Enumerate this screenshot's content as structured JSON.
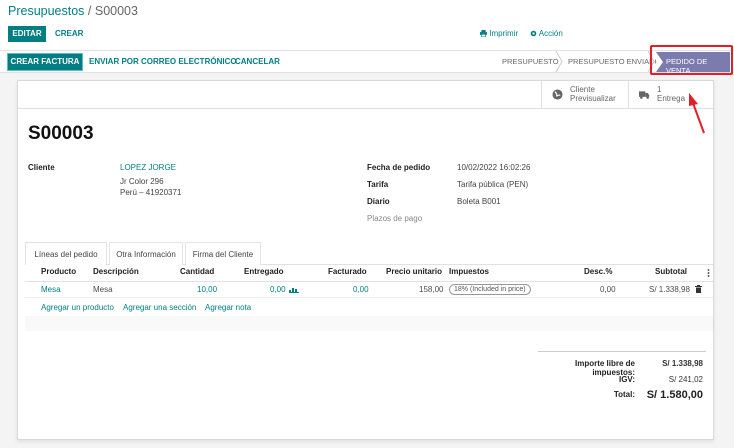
{
  "breadcrumb": {
    "parent": "Presupuestos",
    "separator": " / ",
    "current": "S00003"
  },
  "control": {
    "edit": "EDITAR",
    "create": "CREAR",
    "print": "Imprimir",
    "action": "Acción"
  },
  "statusbar": {
    "invoice": "CREAR FACTURA",
    "send_email": "ENVIAR POR CORREO ELECTRÓNICO",
    "cancel": "CANCELAR",
    "steps": [
      "PRESUPUESTO",
      "PRESUPUESTO ENVIADO",
      "PEDIDO DE VENTA"
    ],
    "active_step": "PEDIDO DE VENTA"
  },
  "smart_buttons": {
    "preview": {
      "line1": "Cliente",
      "line2": "Previsualizar",
      "icon": "globe-icon"
    },
    "delivery": {
      "line1": "1",
      "line2": "Entrega",
      "icon": "truck-icon"
    }
  },
  "order": {
    "name": "S00003",
    "customer_label": "Cliente",
    "customer_name": "LOPEZ JORGE",
    "customer_addr1": "Jr Color 296",
    "customer_addr2": "Perú – 41920371",
    "date_label": "Fecha de pedido",
    "date_value": "10/02/2022 16:02:26",
    "pricelist_label": "Tarifa",
    "pricelist_value": "Tarifa pública (PEN)",
    "journal_label": "Diario",
    "journal_value": "Boleta B001",
    "payment_terms_label": "Plazos de pago"
  },
  "tabs": [
    "Líneas del pedido",
    "Otra Información",
    "Firma del Cliente"
  ],
  "lines_table": {
    "headers": {
      "product": "Producto",
      "description": "Descripción",
      "quantity": "Cantidad",
      "delivered": "Entregado",
      "invoiced": "Facturado",
      "price": "Precio unitario",
      "taxes": "Impuestos",
      "discount": "Desc.%",
      "subtotal": "Subtotal"
    },
    "rows": [
      {
        "product": "Mesa",
        "description": "Mesa",
        "quantity": "10,00",
        "delivered": "0,00",
        "invoiced": "0,00",
        "price": "158,00",
        "tax": "18% (Included in price)",
        "discount": "0,00",
        "subtotal": "S/ 1.338,98"
      }
    ],
    "add_product": "Agregar un producto",
    "add_section": "Agregar una sección",
    "add_note": "Agregar nota"
  },
  "totals": {
    "untaxed_label": "Importe libre de impuestos:",
    "untaxed_value": "S/ 1.338,98",
    "tax_label": "IGV:",
    "tax_value": "S/ 241,02",
    "total_label": "Total:",
    "total_value": "S/ 1.580,00"
  },
  "colors": {
    "primary": "#017e84",
    "status_active": "#7c7bad",
    "highlight": "#e41e26"
  }
}
